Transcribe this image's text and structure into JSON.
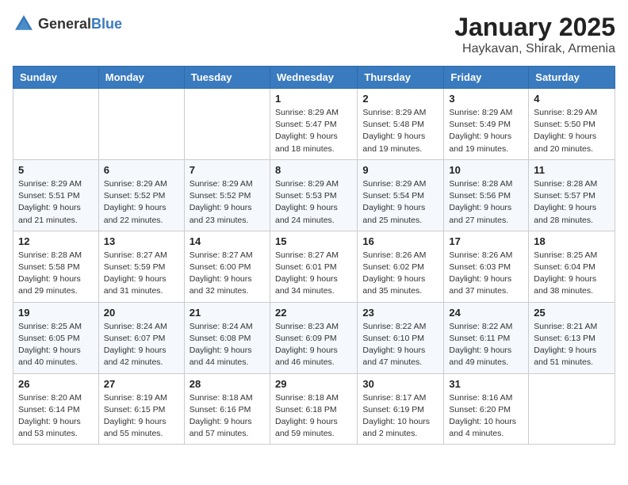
{
  "logo": {
    "general": "General",
    "blue": "Blue"
  },
  "title": "January 2025",
  "location": "Haykavan, Shirak, Armenia",
  "weekdays": [
    "Sunday",
    "Monday",
    "Tuesday",
    "Wednesday",
    "Thursday",
    "Friday",
    "Saturday"
  ],
  "weeks": [
    [
      {
        "day": "",
        "detail": ""
      },
      {
        "day": "",
        "detail": ""
      },
      {
        "day": "",
        "detail": ""
      },
      {
        "day": "1",
        "detail": "Sunrise: 8:29 AM\nSunset: 5:47 PM\nDaylight: 9 hours\nand 18 minutes."
      },
      {
        "day": "2",
        "detail": "Sunrise: 8:29 AM\nSunset: 5:48 PM\nDaylight: 9 hours\nand 19 minutes."
      },
      {
        "day": "3",
        "detail": "Sunrise: 8:29 AM\nSunset: 5:49 PM\nDaylight: 9 hours\nand 19 minutes."
      },
      {
        "day": "4",
        "detail": "Sunrise: 8:29 AM\nSunset: 5:50 PM\nDaylight: 9 hours\nand 20 minutes."
      }
    ],
    [
      {
        "day": "5",
        "detail": "Sunrise: 8:29 AM\nSunset: 5:51 PM\nDaylight: 9 hours\nand 21 minutes."
      },
      {
        "day": "6",
        "detail": "Sunrise: 8:29 AM\nSunset: 5:52 PM\nDaylight: 9 hours\nand 22 minutes."
      },
      {
        "day": "7",
        "detail": "Sunrise: 8:29 AM\nSunset: 5:52 PM\nDaylight: 9 hours\nand 23 minutes."
      },
      {
        "day": "8",
        "detail": "Sunrise: 8:29 AM\nSunset: 5:53 PM\nDaylight: 9 hours\nand 24 minutes."
      },
      {
        "day": "9",
        "detail": "Sunrise: 8:29 AM\nSunset: 5:54 PM\nDaylight: 9 hours\nand 25 minutes."
      },
      {
        "day": "10",
        "detail": "Sunrise: 8:28 AM\nSunset: 5:56 PM\nDaylight: 9 hours\nand 27 minutes."
      },
      {
        "day": "11",
        "detail": "Sunrise: 8:28 AM\nSunset: 5:57 PM\nDaylight: 9 hours\nand 28 minutes."
      }
    ],
    [
      {
        "day": "12",
        "detail": "Sunrise: 8:28 AM\nSunset: 5:58 PM\nDaylight: 9 hours\nand 29 minutes."
      },
      {
        "day": "13",
        "detail": "Sunrise: 8:27 AM\nSunset: 5:59 PM\nDaylight: 9 hours\nand 31 minutes."
      },
      {
        "day": "14",
        "detail": "Sunrise: 8:27 AM\nSunset: 6:00 PM\nDaylight: 9 hours\nand 32 minutes."
      },
      {
        "day": "15",
        "detail": "Sunrise: 8:27 AM\nSunset: 6:01 PM\nDaylight: 9 hours\nand 34 minutes."
      },
      {
        "day": "16",
        "detail": "Sunrise: 8:26 AM\nSunset: 6:02 PM\nDaylight: 9 hours\nand 35 minutes."
      },
      {
        "day": "17",
        "detail": "Sunrise: 8:26 AM\nSunset: 6:03 PM\nDaylight: 9 hours\nand 37 minutes."
      },
      {
        "day": "18",
        "detail": "Sunrise: 8:25 AM\nSunset: 6:04 PM\nDaylight: 9 hours\nand 38 minutes."
      }
    ],
    [
      {
        "day": "19",
        "detail": "Sunrise: 8:25 AM\nSunset: 6:05 PM\nDaylight: 9 hours\nand 40 minutes."
      },
      {
        "day": "20",
        "detail": "Sunrise: 8:24 AM\nSunset: 6:07 PM\nDaylight: 9 hours\nand 42 minutes."
      },
      {
        "day": "21",
        "detail": "Sunrise: 8:24 AM\nSunset: 6:08 PM\nDaylight: 9 hours\nand 44 minutes."
      },
      {
        "day": "22",
        "detail": "Sunrise: 8:23 AM\nSunset: 6:09 PM\nDaylight: 9 hours\nand 46 minutes."
      },
      {
        "day": "23",
        "detail": "Sunrise: 8:22 AM\nSunset: 6:10 PM\nDaylight: 9 hours\nand 47 minutes."
      },
      {
        "day": "24",
        "detail": "Sunrise: 8:22 AM\nSunset: 6:11 PM\nDaylight: 9 hours\nand 49 minutes."
      },
      {
        "day": "25",
        "detail": "Sunrise: 8:21 AM\nSunset: 6:13 PM\nDaylight: 9 hours\nand 51 minutes."
      }
    ],
    [
      {
        "day": "26",
        "detail": "Sunrise: 8:20 AM\nSunset: 6:14 PM\nDaylight: 9 hours\nand 53 minutes."
      },
      {
        "day": "27",
        "detail": "Sunrise: 8:19 AM\nSunset: 6:15 PM\nDaylight: 9 hours\nand 55 minutes."
      },
      {
        "day": "28",
        "detail": "Sunrise: 8:18 AM\nSunset: 6:16 PM\nDaylight: 9 hours\nand 57 minutes."
      },
      {
        "day": "29",
        "detail": "Sunrise: 8:18 AM\nSunset: 6:18 PM\nDaylight: 9 hours\nand 59 minutes."
      },
      {
        "day": "30",
        "detail": "Sunrise: 8:17 AM\nSunset: 6:19 PM\nDaylight: 10 hours\nand 2 minutes."
      },
      {
        "day": "31",
        "detail": "Sunrise: 8:16 AM\nSunset: 6:20 PM\nDaylight: 10 hours\nand 4 minutes."
      },
      {
        "day": "",
        "detail": ""
      }
    ]
  ]
}
